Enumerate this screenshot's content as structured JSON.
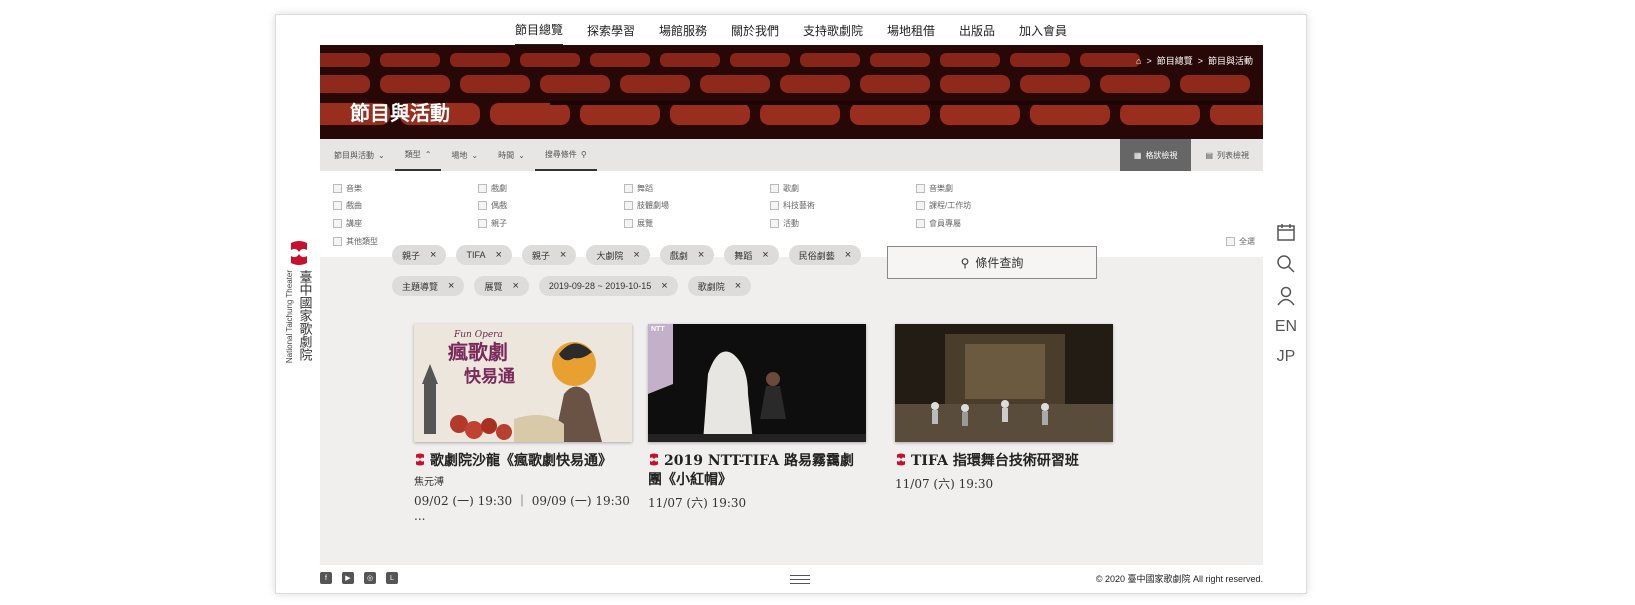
{
  "nav": [
    "節目總覽",
    "探索學習",
    "場館服務",
    "關於我們",
    "支持歌劇院",
    "場地租借",
    "出版品",
    "加入會員"
  ],
  "logo": {
    "zh": "臺中國家歌劇院",
    "en": "National Taichung Theater"
  },
  "banner": {
    "title": "節目與活動",
    "crumbs": [
      "節目總覽",
      ">",
      "節目與活動"
    ]
  },
  "filters": [
    {
      "label": "節目與活動",
      "arrow": "⌄"
    },
    {
      "label": "類型",
      "arrow": "⌃"
    },
    {
      "label": "場地",
      "arrow": "⌄"
    },
    {
      "label": "時間",
      "arrow": "⌄"
    },
    {
      "label": "搜尋條件",
      "arrow": "🔍"
    }
  ],
  "views": {
    "grid": "格狀檢視",
    "list": "列表檢視"
  },
  "options": [
    [
      "音樂",
      "戲劇",
      "舞蹈",
      "歌劇",
      "音樂劇"
    ],
    [
      "戲曲",
      "偶戲",
      "肢體劇場",
      "科技藝術",
      "課程/工作坊"
    ],
    [
      "講座",
      "親子",
      "展覽",
      "活動",
      "會員專屬"
    ],
    [
      "其他類型"
    ]
  ],
  "select_all": "全選",
  "tags": [
    "親子",
    "TIFA",
    "親子",
    "大劇院",
    "戲劇",
    "舞蹈",
    "民俗劇藝",
    "主題導覽",
    "展覽",
    "2019-09-28 ~ 2019-10-15",
    "歌劇院"
  ],
  "query_label": "條件查詢",
  "cards": [
    {
      "title": "歌劇院沙龍《瘋歌劇快易通》",
      "sub": "焦元溥",
      "date": "09/02 (一) 19:30 ｜ 09/09 (一) 19:30 ..."
    },
    {
      "title": "2019 NTT-TIFA 路易霧靄劇團《小紅帽》",
      "sub": "",
      "date": "11/07 (六) 19:30"
    },
    {
      "title": "TIFA 指環舞台技術研習班",
      "sub": "",
      "date": "11/07 (六) 19:30"
    }
  ],
  "thumb1": {
    "line1": "Fun Opera",
    "line2": "瘋歌劇",
    "line3": "快易通"
  },
  "thumb2": {
    "tag": "NTT"
  },
  "footer": {
    "copyright": "© 2020 臺中國家歌劇院  All right reserved."
  },
  "side": {
    "en": "EN",
    "jp": "JP"
  },
  "colors": {
    "brand": "#c8102e",
    "dark": "#3a0f0a"
  }
}
